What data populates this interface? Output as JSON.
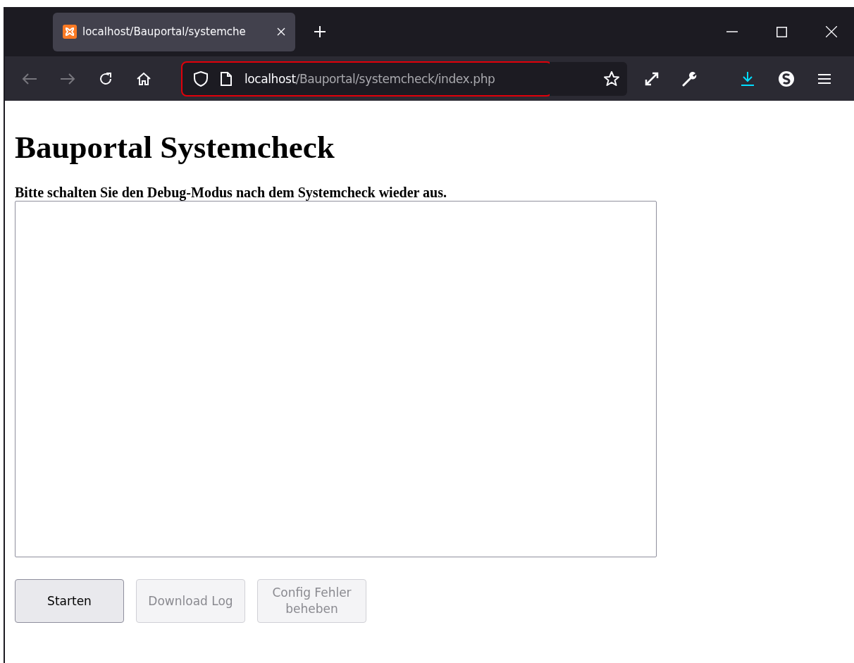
{
  "tab": {
    "title": "localhost/Bauportal/systemche",
    "selected": true
  },
  "nav": {
    "back_disabled": true,
    "forward_disabled": true
  },
  "address_bar": {
    "host": "localhost",
    "path": "/Bauportal/systemcheck/index.php",
    "highlighted": true
  },
  "page": {
    "heading": "Bauportal Systemcheck",
    "notice": "Bitte schalten Sie den Debug-Modus nach dem Systemcheck wieder aus.",
    "buttons": [
      {
        "label": "Starten",
        "disabled": false
      },
      {
        "label": "Download Log",
        "disabled": true
      },
      {
        "label": "Config Fehler beheben",
        "disabled": true
      }
    ]
  }
}
